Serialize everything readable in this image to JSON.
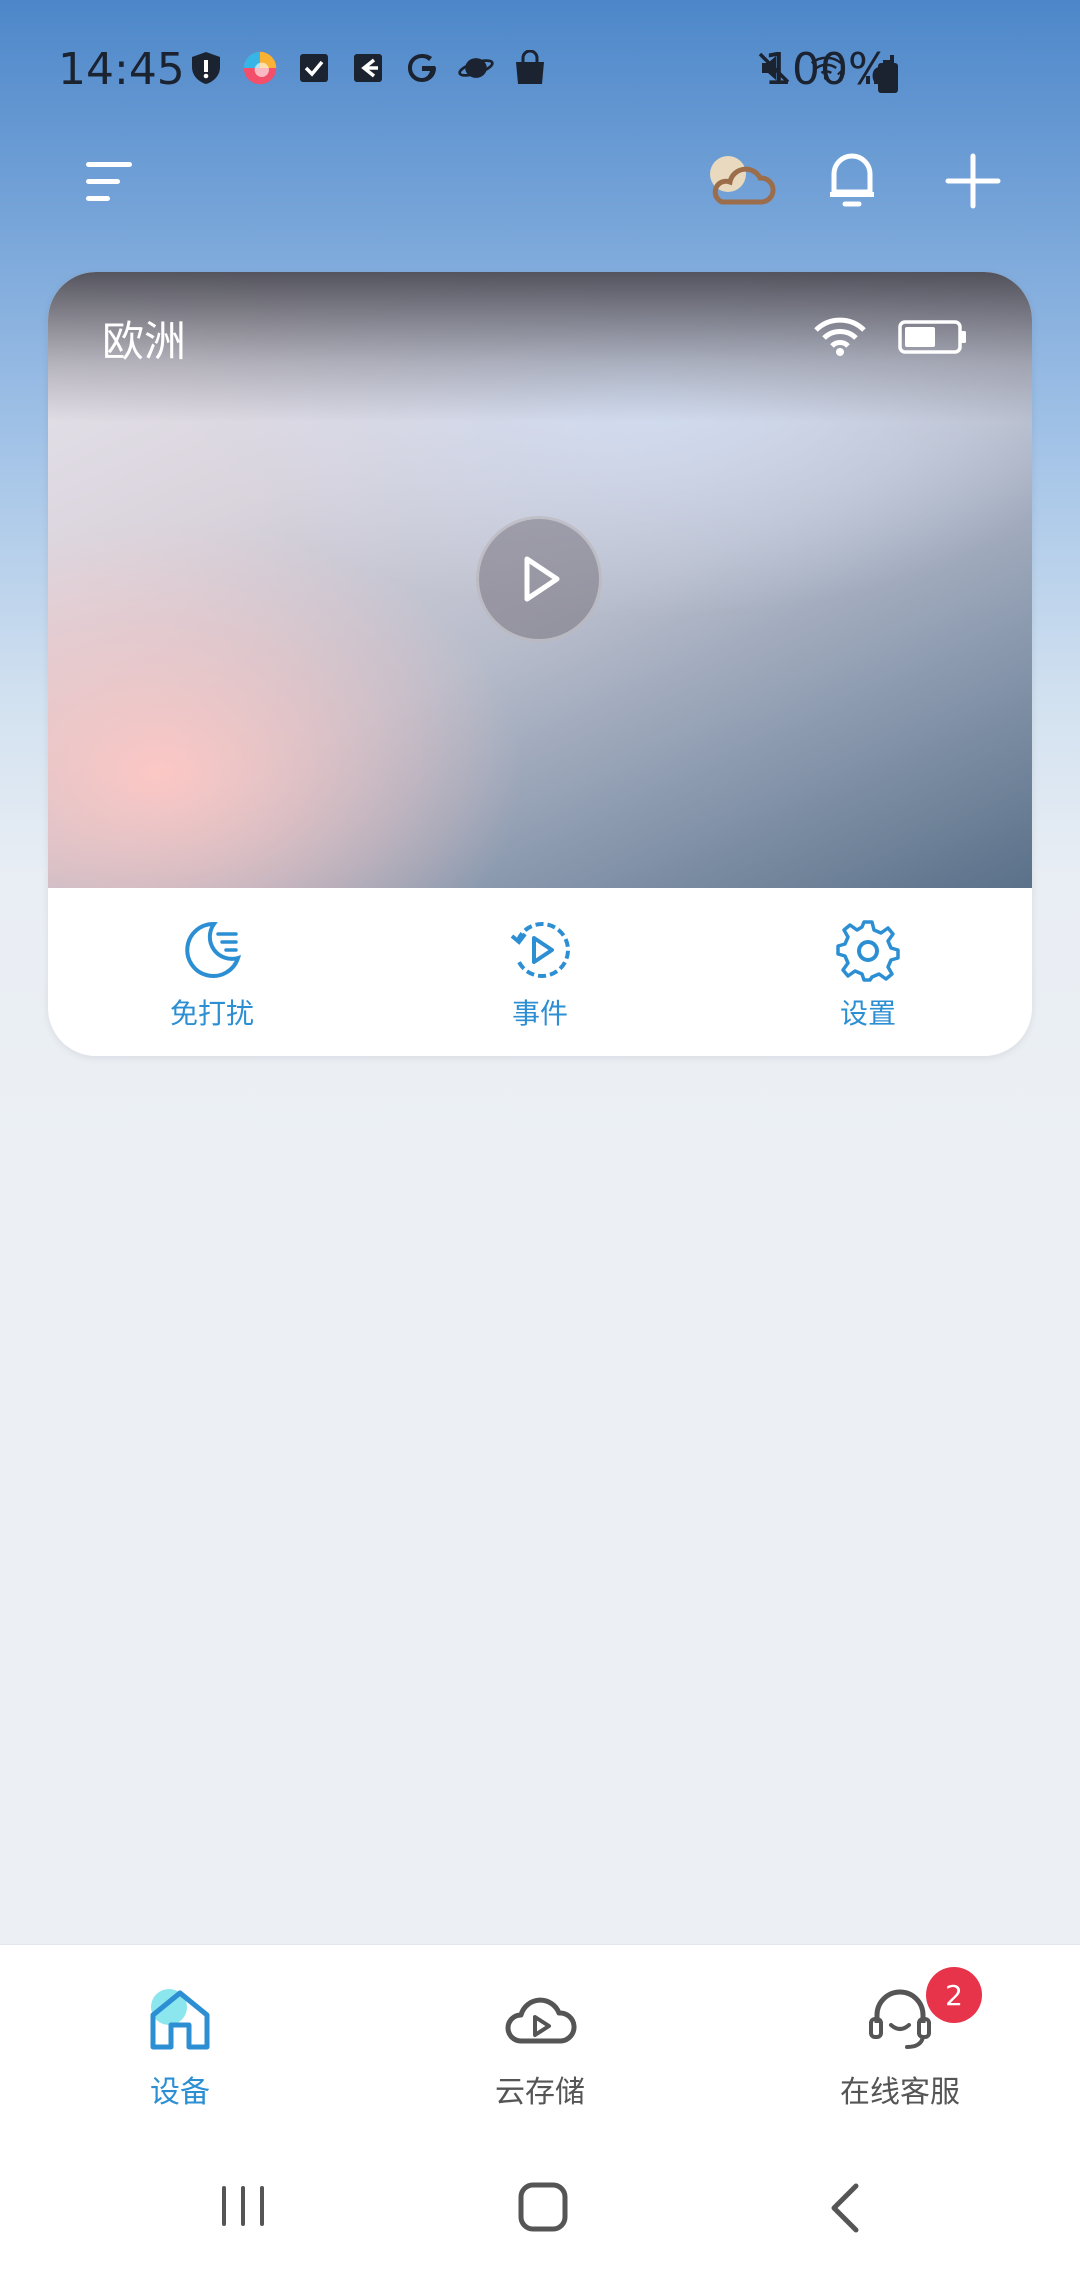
{
  "status_bar": {
    "time": "14:45",
    "battery_percent": "100%",
    "left_icons": [
      "shield-icon",
      "browser-icon",
      "check-icon",
      "signin-icon",
      "google-icon",
      "planet-icon",
      "bag-icon"
    ],
    "right_icons": [
      "mute-icon",
      "wifi-icon",
      "signal-icon",
      "battery-icon"
    ]
  },
  "top_bar": {
    "icons": [
      "menu-icon",
      "weather-icon",
      "bell-icon",
      "plus-icon"
    ]
  },
  "device_card": {
    "name": "欧洲",
    "actions": [
      {
        "label": "免打扰",
        "icon": "moon-icon"
      },
      {
        "label": "事件",
        "icon": "event-playback-icon"
      },
      {
        "label": "设置",
        "icon": "gear-icon"
      }
    ]
  },
  "bottom_nav": {
    "items": [
      {
        "label": "设备",
        "icon": "home-icon",
        "active": true
      },
      {
        "label": "云存储",
        "icon": "cloud-play-icon",
        "active": false
      },
      {
        "label": "在线客服",
        "icon": "headset-icon",
        "active": false,
        "badge": "2"
      }
    ]
  },
  "colors": {
    "accent": "#2d8fd3",
    "badge": "#e8344a",
    "header_blue": "#4d87c9"
  }
}
